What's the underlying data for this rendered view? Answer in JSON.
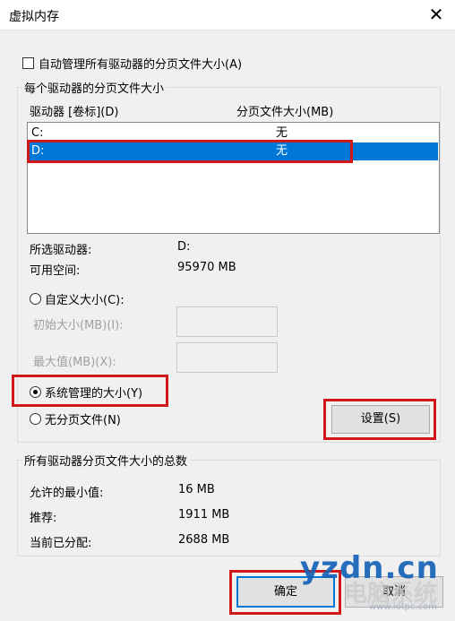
{
  "window": {
    "title": "虚拟内存",
    "close_glyph": "✕"
  },
  "auto_manage": {
    "label": "自动管理所有驱动器的分页文件大小(A)",
    "checked": false
  },
  "drives_group": {
    "legend": "每个驱动器的分页文件大小",
    "col_drive": "驱动器 [卷标](D)",
    "col_size": "分页文件大小(MB)",
    "rows": [
      {
        "drive": "C:",
        "size": "无",
        "selected": false
      },
      {
        "drive": "D:",
        "size": "无",
        "selected": true
      }
    ],
    "selected_drive_label": "所选驱动器:",
    "selected_drive_value": "D:",
    "free_space_label": "可用空间:",
    "free_space_value": "95970 MB",
    "custom_size_label": "自定义大小(C):",
    "initial_size_label": "初始大小(MB)(I):",
    "initial_size_value": "",
    "max_size_label": "最大值(MB)(X):",
    "max_size_value": "",
    "system_managed_label": "系统管理的大小(Y)",
    "no_paging_label": "无分页文件(N)",
    "selected_option": "system_managed",
    "set_button": "设置(S)"
  },
  "totals_group": {
    "legend": "所有驱动器分页文件大小的总数",
    "min_allowed_label": "允许的最小值:",
    "min_allowed_value": "16 MB",
    "recommended_label": "推荐:",
    "recommended_value": "1911 MB",
    "current_label": "当前已分配:",
    "current_value": "2688 MB"
  },
  "buttons": {
    "ok": "确定",
    "cancel": "取消"
  },
  "watermark": {
    "main": "yzdn.cn",
    "bg": "电脑系统",
    "sub": "www.lotpc.com"
  },
  "colors": {
    "selection": "#0078d7",
    "annotation_red": "#d01818",
    "watermark_blue": "#1563b8"
  }
}
